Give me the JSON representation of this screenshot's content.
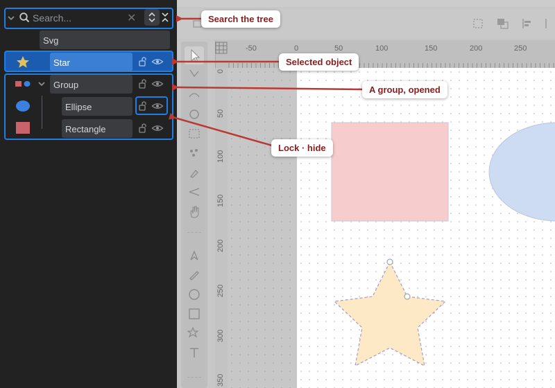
{
  "search": {
    "placeholder": "Search..."
  },
  "tree": {
    "root": "Svg",
    "items": [
      {
        "label": "Star",
        "icon": "star-icon"
      },
      {
        "label": "Group",
        "icon": "group-icon"
      },
      {
        "label": "Ellipse",
        "icon": "ellipse-icon"
      },
      {
        "label": "Rectangle",
        "icon": "rectangle-icon"
      }
    ]
  },
  "rulers": {
    "horizontal": [
      "-50",
      "0",
      "50",
      "100",
      "150",
      "200",
      "250"
    ],
    "vertical": [
      "0",
      "50",
      "100",
      "150",
      "200",
      "250",
      "300",
      "350"
    ]
  },
  "callouts": {
    "search": "Search the tree",
    "selected": "Selected object",
    "group": "A group, opened",
    "lock": "Lock · hide"
  },
  "colors": {
    "panel_bg": "#222222",
    "highlight": "#1f7fe6",
    "selected_row": "#2f6fc2",
    "callout_text": "#8a1c1c",
    "arrow": "#b83a32",
    "star_fill": "#fde9c6",
    "rect_fill": "#f6cccc",
    "ellipse_fill": "#cddcf3"
  }
}
